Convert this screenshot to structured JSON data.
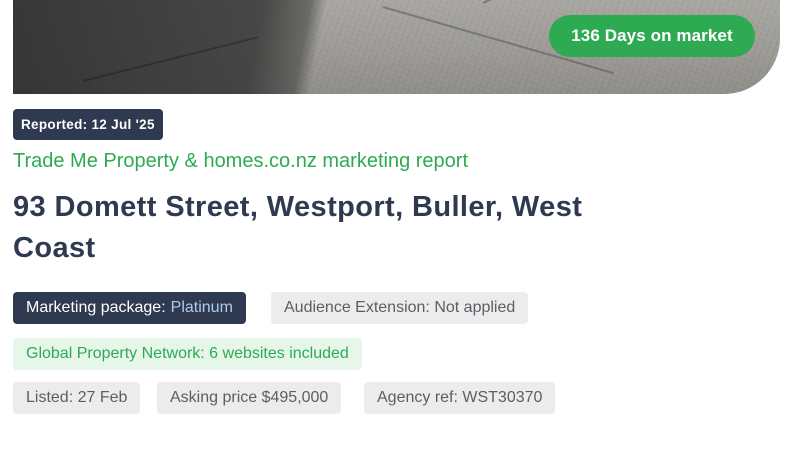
{
  "hero": {
    "days_on_market": "136 Days on market"
  },
  "report": {
    "reported_date": "Reported: 12 Jul '25",
    "title": "Trade Me Property & homes.co.nz marketing report",
    "address": "93 Domett Street, Westport, Buller, West Coast"
  },
  "package": {
    "label": "Marketing package:",
    "value": "Platinum"
  },
  "chips": {
    "audience_extension": "Audience Extension: Not applied",
    "global_network": "Global Property Network: 6 websites included",
    "listed": "Listed: 27 Feb",
    "asking_price": "Asking price $495,000",
    "agency_ref": "Agency ref: WST30370"
  },
  "colors": {
    "brand_green": "#2eaa52",
    "navy": "#2f3a50",
    "accent_blue": "#aecbef",
    "chip_grey": "#ececec",
    "chip_green_bg": "#e6f7ea"
  }
}
